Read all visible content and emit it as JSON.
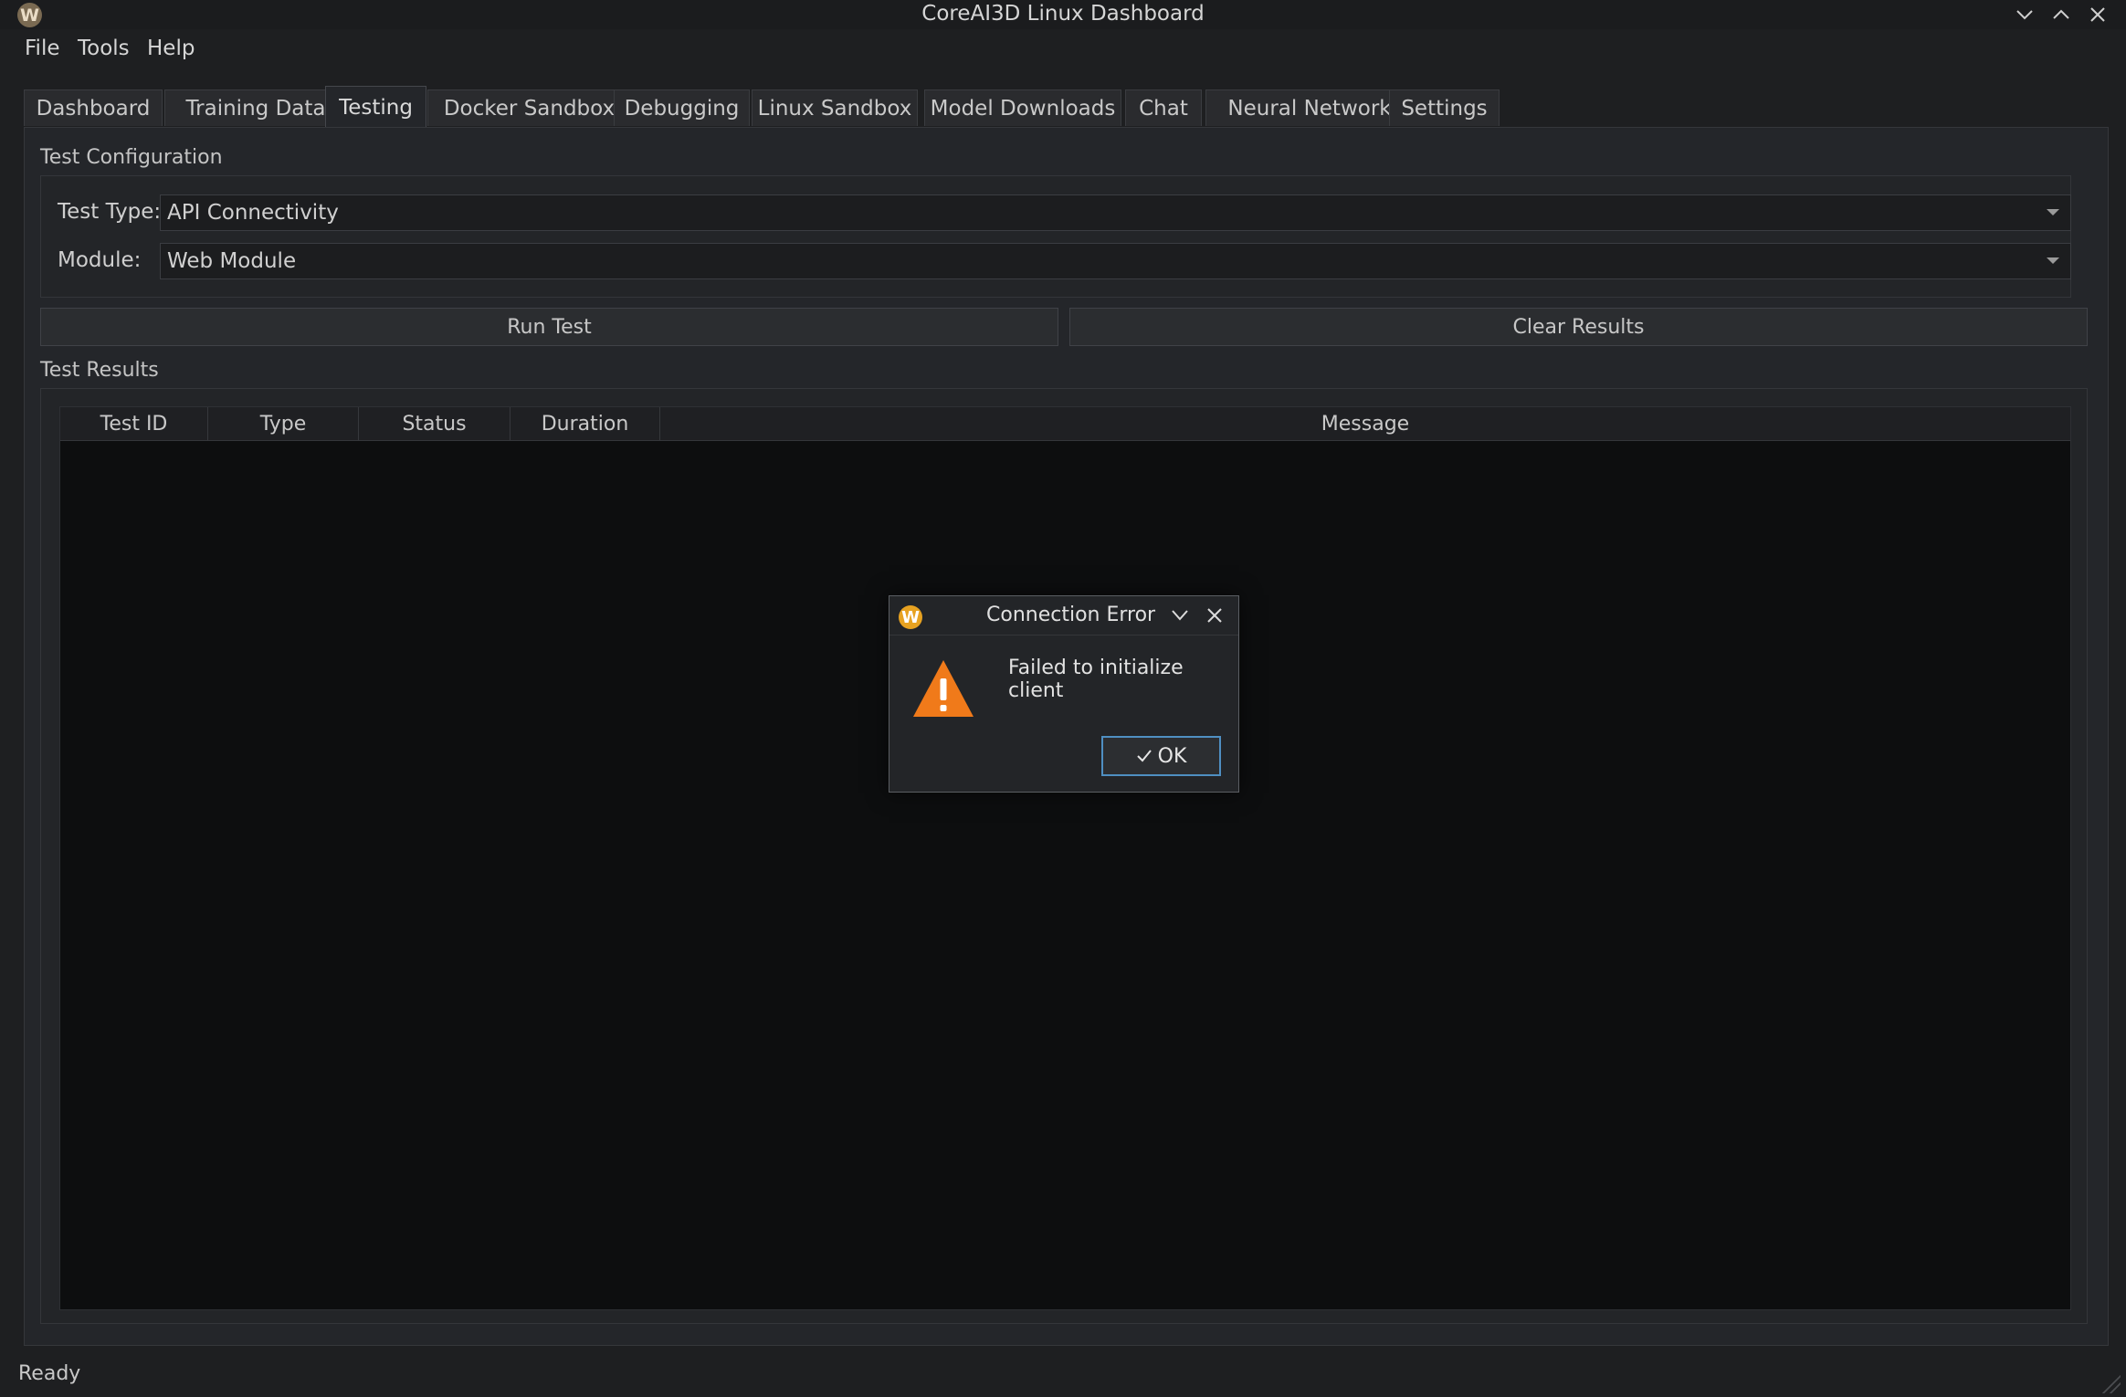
{
  "window": {
    "title": "CoreAI3D Linux Dashboard",
    "logo_letter": "W"
  },
  "menu": {
    "items": [
      "File",
      "Tools",
      "Help"
    ]
  },
  "tabs": [
    "Dashboard",
    "Training Data",
    "Testing",
    "Docker Sandbox",
    "Debugging",
    "Linux Sandbox",
    "Model Downloads",
    "Chat",
    "Neural Network",
    "Settings"
  ],
  "active_tab": "Testing",
  "test_config": {
    "title": "Test Configuration",
    "test_type_label": "Test Type:",
    "test_type_value": "API Connectivity",
    "module_label": "Module:",
    "module_value": "Web Module"
  },
  "buttons": {
    "run": "Run Test",
    "clear": "Clear Results"
  },
  "results": {
    "title": "Test Results",
    "columns": [
      "Test ID",
      "Type",
      "Status",
      "Duration",
      "Message"
    ]
  },
  "status": {
    "text": "Ready"
  },
  "dialog": {
    "title": "Connection Error",
    "message": "Failed to initialize client",
    "ok_label": "OK",
    "logo_letter": "W",
    "warning_color": "#f07a1a"
  }
}
